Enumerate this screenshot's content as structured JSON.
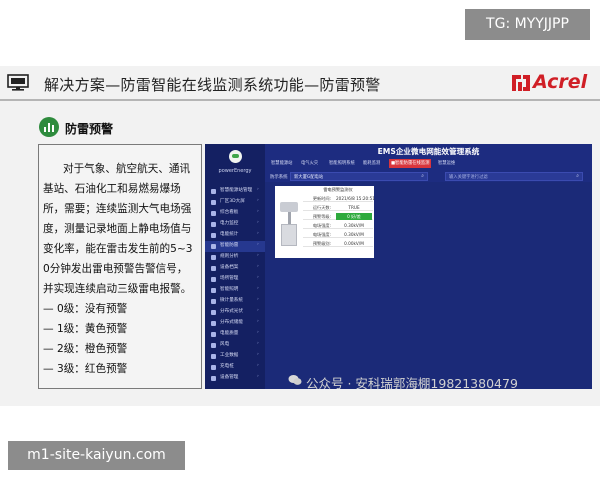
{
  "badges": {
    "tg": "TG: MYYJJPP",
    "site": "m1-site-kaiyun.com"
  },
  "slide": {
    "title": "解决方案—防雷智能在线监测系统功能—防雷预警",
    "brand": "Acrel",
    "section_label": "防雷预警",
    "paragraph": "对于气象、航空航天、通讯基站、石油化工和易燃易爆场所，需要；连续监测大气电场强度，测量记录地面上静电场值与变化率，能在雷击发生前的5~30分钟发出雷电预警告警信号，并实现连续启动三级雷电报警。",
    "levels": [
      "— 0级：没有预警",
      "— 1级：黄色预警",
      "— 2级：橙色预警",
      "— 3级：红色预警"
    ]
  },
  "app": {
    "title": "EMS企业微电网能效管理系统",
    "logo_text": "powerEnergy",
    "nav_tabs": [
      {
        "label": "智慧能源站",
        "active": false
      },
      {
        "label": "电气火灾",
        "active": false
      },
      {
        "label": "智能照明系统",
        "active": false
      },
      {
        "label": "能耗监测",
        "active": false
      },
      {
        "label": "■智能防雷在线监测",
        "active": true
      },
      {
        "label": "智慧运维",
        "active": false
      }
    ],
    "sidebar_items": [
      {
        "label": "智慧能源站管理",
        "active": false
      },
      {
        "label": "厂区3D大屏",
        "active": false
      },
      {
        "label": "综合看板",
        "active": false
      },
      {
        "label": "电力监控",
        "active": false
      },
      {
        "label": "电能统计",
        "active": false
      },
      {
        "label": "智能防雷",
        "active": true
      },
      {
        "label": "规则分析",
        "active": false
      },
      {
        "label": "设备档案",
        "active": false
      },
      {
        "label": "场所管理",
        "active": false
      },
      {
        "label": "智能照明",
        "active": false
      },
      {
        "label": "微计量系统",
        "active": false
      },
      {
        "label": "分布式光伏",
        "active": false
      },
      {
        "label": "分布式储能",
        "active": false
      },
      {
        "label": "电能质量",
        "active": false
      },
      {
        "label": "风电",
        "active": false
      },
      {
        "label": "工业数据",
        "active": false
      },
      {
        "label": "充电桩",
        "active": false
      },
      {
        "label": "设备管理",
        "active": false
      }
    ],
    "filter": {
      "label": "防示系统",
      "select_value": "新大厦G配电站",
      "input_placeholder": "输入关键字进行过滤"
    },
    "device_card": {
      "title": "雷电预警监测仪",
      "rows": [
        {
          "key": "更新时间:",
          "value": "2021/6/8 15:20:51",
          "alarm": false
        },
        {
          "key": "运行天数:",
          "value": "TRUE",
          "alarm": false
        },
        {
          "key": "预警等级:",
          "value": "0 好/差",
          "alarm": true
        },
        {
          "key": "电场强度:",
          "value": "0.30kV/M",
          "alarm": false
        },
        {
          "key": "电场强度:",
          "value": "0.30kV/M",
          "alarm": false
        },
        {
          "key": "预警级别:",
          "value": "0.00kV/M",
          "alarm": false
        }
      ]
    }
  },
  "watermark": "公众号 · 安科瑞郭海棚19821380479"
}
